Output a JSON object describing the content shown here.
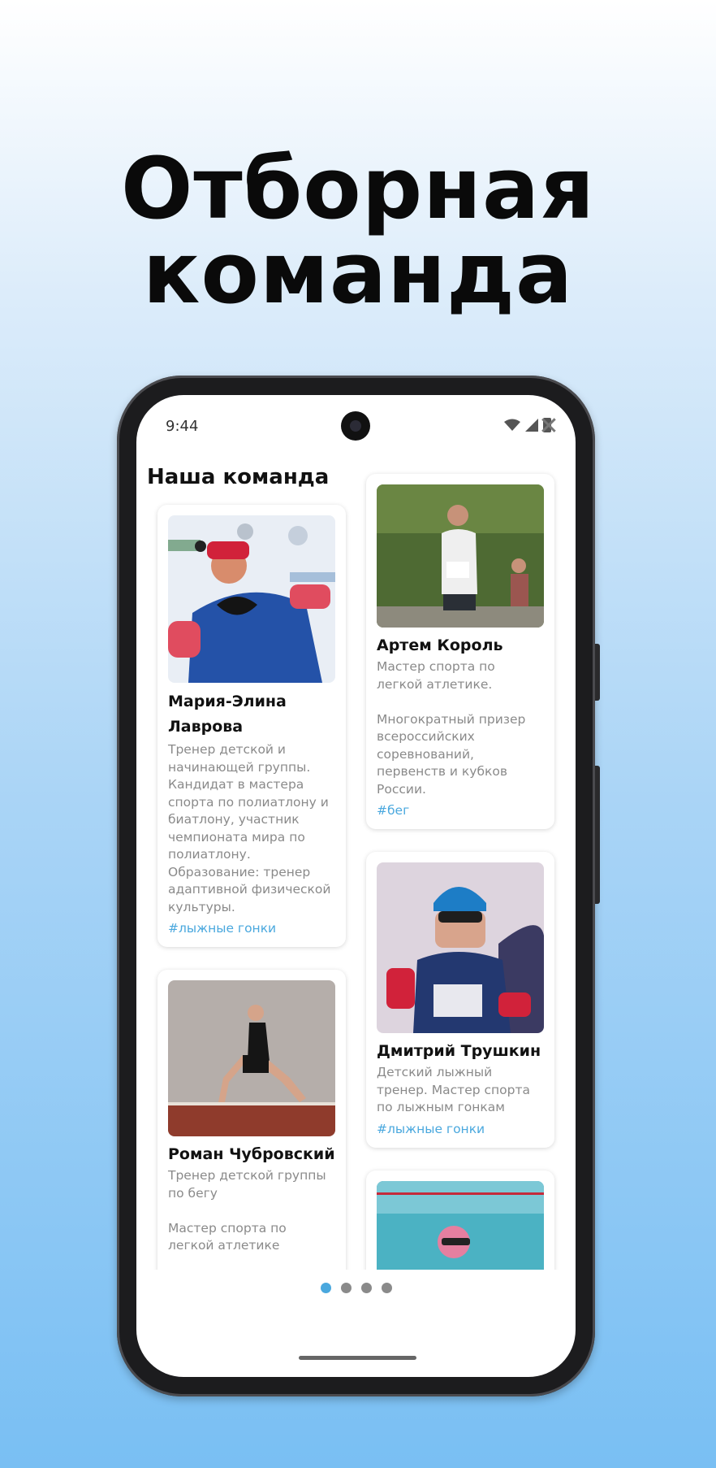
{
  "hero": {
    "line1": "Отборная",
    "line2": "команда"
  },
  "status": {
    "time": "9:44"
  },
  "screen": {
    "title": "Наша команда",
    "close_symbol": "✕"
  },
  "team": [
    {
      "name": "Мария-Элина Лаврова",
      "description": "Тренер детской и начинающей группы. Кандидат в мастера спорта по полиатлону и биатлону, участник чемпионата мира по полиатлону.\nОбразование: тренер адаптивной физической культуры.",
      "tag": "#лыжные гонки"
    },
    {
      "name": "Артем Король",
      "description": "Мастер спорта по легкой атлетике.\n\nМногократный призер всероссийских соревнований, первенств и кубков России.",
      "tag": "#бег"
    },
    {
      "name": "Роман Чубровский",
      "description": "Тренер детской группы по бегу\n\nМастер спорта по легкой атлетике\n\nБронзовый призёр Чемпионата России",
      "tag": ""
    },
    {
      "name": "Дмитрий Трушкин",
      "description": "Детский лыжный тренер. Мастер спорта по лыжным гонкам",
      "tag": "#лыжные гонки"
    }
  ],
  "pagination": {
    "total": 4,
    "active": 1
  },
  "colors": {
    "accent": "#4aa8de",
    "text_muted": "#8a8a8a"
  },
  "icons": [
    "wifi-icon",
    "signal-icon",
    "battery-icon",
    "close-icon"
  ]
}
